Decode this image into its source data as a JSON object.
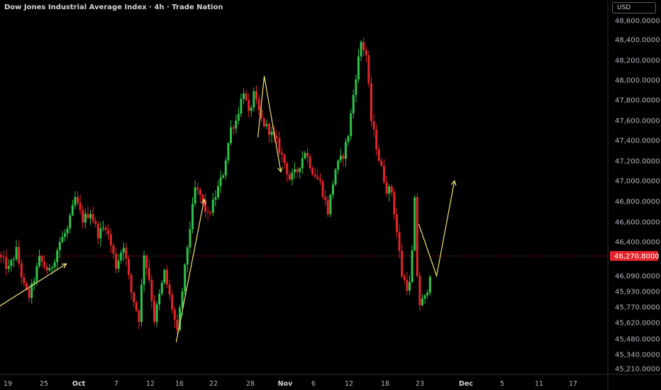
{
  "header": {
    "title": "Dow Jones Industrial Average Index · 4h · Trade Nation",
    "currency": "USD"
  },
  "colors": {
    "background": "#000000",
    "up": "#2ec24a",
    "down": "#e2262b",
    "drawing": "#f2e37a",
    "price_line": "#e2262b",
    "axis_text": "#b2b5be"
  },
  "chart_data": {
    "type": "candlestick",
    "symbol": "Dow Jones Industrial Average Index",
    "interval": "4h",
    "ylim": [
      45130,
      48700
    ],
    "y_ticks": [
      48600,
      48400,
      48200,
      48000,
      47800,
      47600,
      47400,
      47200,
      47000,
      46800,
      46600,
      46400,
      46090,
      45930,
      45770,
      45620,
      45480,
      45340,
      45210
    ],
    "y_tick_labels": [
      "48,600.0000",
      "48,400.0000",
      "48,200.0000",
      "48,000.0000",
      "47,800.0000",
      "47,600.0000",
      "47,400.0000",
      "47,200.0000",
      "47,000.0000",
      "46,800.0000",
      "46,600.0000",
      "46,400.0000",
      "46,090.0000",
      "45,930.0000",
      "45,770.0000",
      "45,620.0000",
      "45,480.0000",
      "45,340.0000",
      "45,210.0000"
    ],
    "last_price": 46270.8,
    "last_price_label": "46,270.8000",
    "x_ticks": [
      {
        "label": "19",
        "bold": false
      },
      {
        "label": "25",
        "bold": false
      },
      {
        "label": "Oct",
        "bold": true
      },
      {
        "label": "7",
        "bold": false
      },
      {
        "label": "12",
        "bold": false
      },
      {
        "label": "16",
        "bold": false
      },
      {
        "label": "22",
        "bold": false
      },
      {
        "label": "28",
        "bold": false
      },
      {
        "label": "Nov",
        "bold": true
      },
      {
        "label": "6",
        "bold": false
      },
      {
        "label": "12",
        "bold": false
      },
      {
        "label": "18",
        "bold": false
      },
      {
        "label": "23",
        "bold": false
      },
      {
        "label": "Dec",
        "bold": true
      },
      {
        "label": "5",
        "bold": false
      },
      {
        "label": "11",
        "bold": false
      },
      {
        "label": "17",
        "bold": false
      }
    ],
    "path_keypoints": [
      [
        0,
        46280
      ],
      [
        4,
        46150
      ],
      [
        7,
        46320
      ],
      [
        10,
        45980
      ],
      [
        12,
        45880
      ],
      [
        16,
        46240
      ],
      [
        20,
        46120
      ],
      [
        24,
        46400
      ],
      [
        27,
        46520
      ],
      [
        30,
        46830
      ],
      [
        33,
        46620
      ],
      [
        36,
        46700
      ],
      [
        39,
        46480
      ],
      [
        42,
        46560
      ],
      [
        46,
        46180
      ],
      [
        49,
        46380
      ],
      [
        52,
        45920
      ],
      [
        55,
        45660
      ],
      [
        57,
        46300
      ],
      [
        59,
        46060
      ],
      [
        61,
        45650
      ],
      [
        65,
        46120
      ],
      [
        68,
        45760
      ],
      [
        70,
        45520
      ],
      [
        74,
        46360
      ],
      [
        77,
        46920
      ],
      [
        79,
        46860
      ],
      [
        82,
        46650
      ],
      [
        84,
        46780
      ],
      [
        88,
        47080
      ],
      [
        91,
        47520
      ],
      [
        93,
        47600
      ],
      [
        96,
        47900
      ],
      [
        98,
        47650
      ],
      [
        100,
        47850
      ],
      [
        103,
        47600
      ],
      [
        106,
        47500
      ],
      [
        109,
        47380
      ],
      [
        112,
        47180
      ],
      [
        114,
        47020
      ],
      [
        117,
        47100
      ],
      [
        120,
        47300
      ],
      [
        123,
        47100
      ],
      [
        126,
        46980
      ],
      [
        129,
        46700
      ],
      [
        132,
        47120
      ],
      [
        135,
        47260
      ],
      [
        137,
        47460
      ],
      [
        140,
        48050
      ],
      [
        142,
        48380
      ],
      [
        144,
        48250
      ],
      [
        146,
        47600
      ],
      [
        149,
        47220
      ],
      [
        152,
        46920
      ],
      [
        154,
        46900
      ],
      [
        156,
        46500
      ],
      [
        158,
        46100
      ],
      [
        160,
        45980
      ],
      [
        161,
        46000
      ],
      [
        162,
        46300
      ],
      [
        163,
        46800
      ],
      [
        164,
        46100
      ],
      [
        165,
        45800
      ],
      [
        167,
        45860
      ],
      [
        168,
        45960
      ]
    ],
    "drawings": [
      {
        "type": "polyline",
        "points": [
          [
            "-2",
            45750
          ],
          [
            26,
            46200
          ]
        ]
      },
      {
        "type": "polyline",
        "points": [
          [
            69,
            45450
          ],
          [
            80,
            46820
          ]
        ]
      },
      {
        "type": "polyline",
        "points": [
          [
            101,
            47430
          ],
          [
            103.5,
            48040
          ],
          [
            110,
            47090
          ]
        ]
      },
      {
        "type": "polyline",
        "points": [
          [
            164,
            46580
          ],
          [
            171,
            46090
          ],
          [
            178,
            47000
          ]
        ]
      }
    ]
  }
}
